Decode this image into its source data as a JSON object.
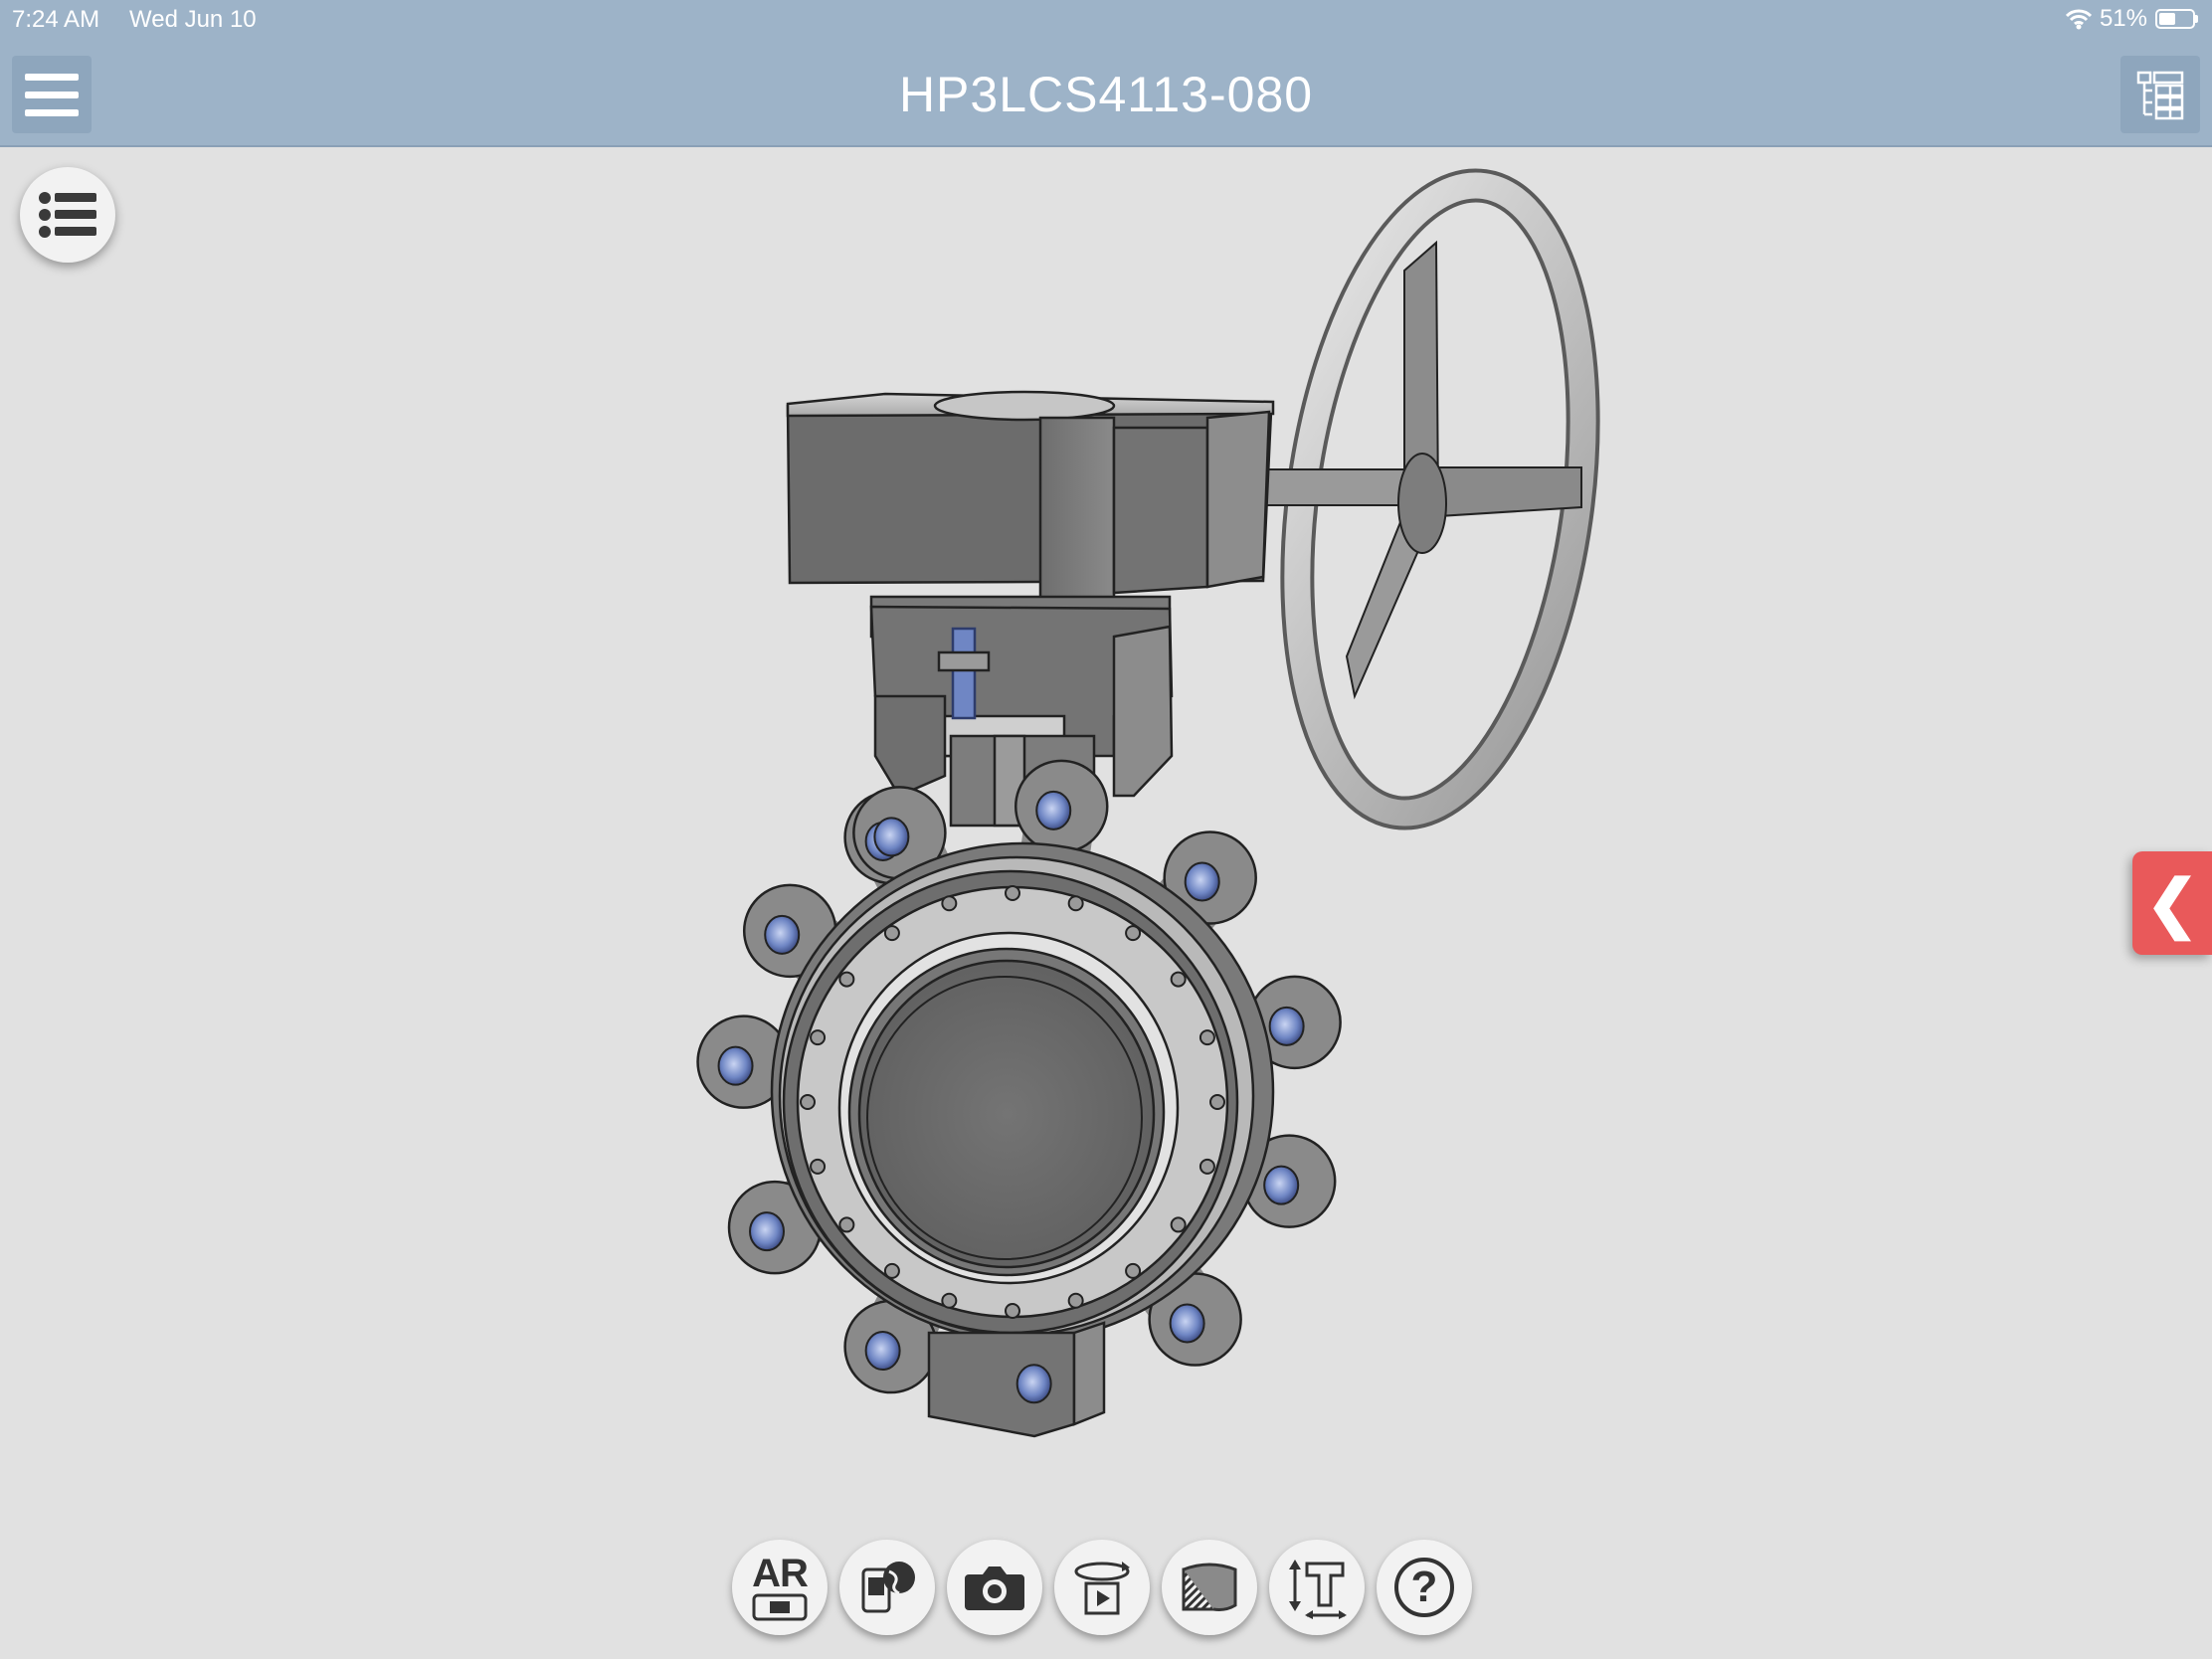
{
  "status_bar": {
    "time": "7:24 AM",
    "date": "Wed Jun 10",
    "battery_text": "51%",
    "battery_level": 0.51
  },
  "header": {
    "title": "HP3LCS4113-080",
    "menu_icon": "hamburger-icon",
    "parts_icon": "parts-list-icon"
  },
  "list_button": {
    "icon": "bulleted-list-icon"
  },
  "side_panel_tab": {
    "glyph": "❮",
    "color": "#e9595a"
  },
  "toolbar": {
    "ar_label": "AR",
    "help_glyph": "?",
    "buttons": [
      "ar-icon",
      "share-globe-icon",
      "camera-icon",
      "rotate-play-icon",
      "cross-section-icon",
      "measure-icon",
      "help-icon"
    ]
  },
  "colors": {
    "header": "#9db3c8",
    "background": "#e1e1e1",
    "accent": "#e9595a",
    "bolt_hole": "#6f86c4"
  }
}
